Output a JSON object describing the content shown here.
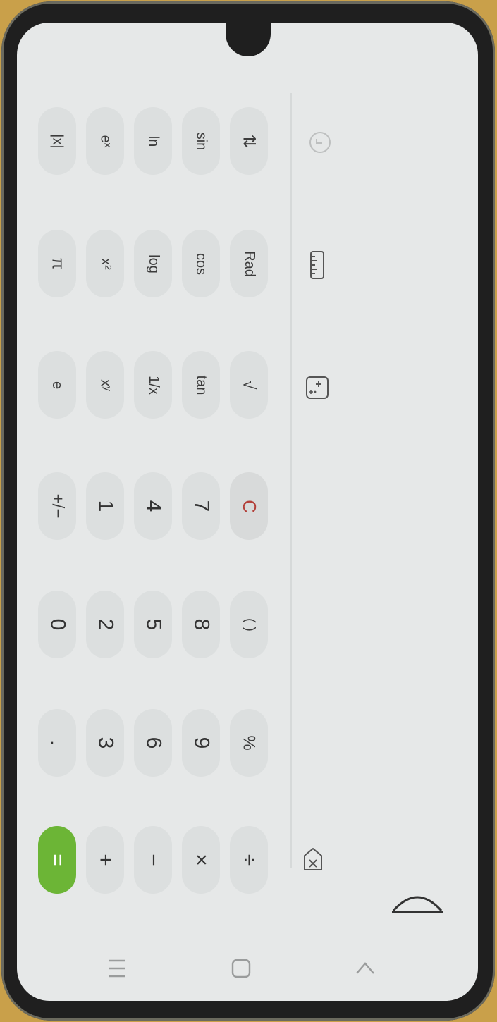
{
  "keypad": {
    "row1": [
      "|x|",
      "π",
      "e",
      "+/−",
      "0",
      ".",
      "="
    ],
    "row2": [
      "eˣ",
      "x²",
      "xʸ",
      "1",
      "2",
      "3",
      "+"
    ],
    "row3": [
      "ln",
      "log",
      "1/x",
      "4",
      "5",
      "6",
      "−"
    ],
    "row4": [
      "sin",
      "cos",
      "tan",
      "7",
      "8",
      "9",
      "×"
    ],
    "row5": [
      "⇅",
      "Rad",
      "√",
      "C",
      "( )",
      "%",
      "÷"
    ]
  },
  "toolbar": {
    "history_icon": "clock-icon",
    "unit_icon": "ruler-icon",
    "scientific_icon": "calculator-icon",
    "backspace_icon": "backspace-icon"
  },
  "nav": {
    "recent": "recent-apps-icon",
    "home": "home-icon",
    "back": "back-icon"
  },
  "colors": {
    "background": "#e6e8e8",
    "key": "#dcdfdf",
    "equals": "#6cb536",
    "clear_text": "#b3403a"
  }
}
